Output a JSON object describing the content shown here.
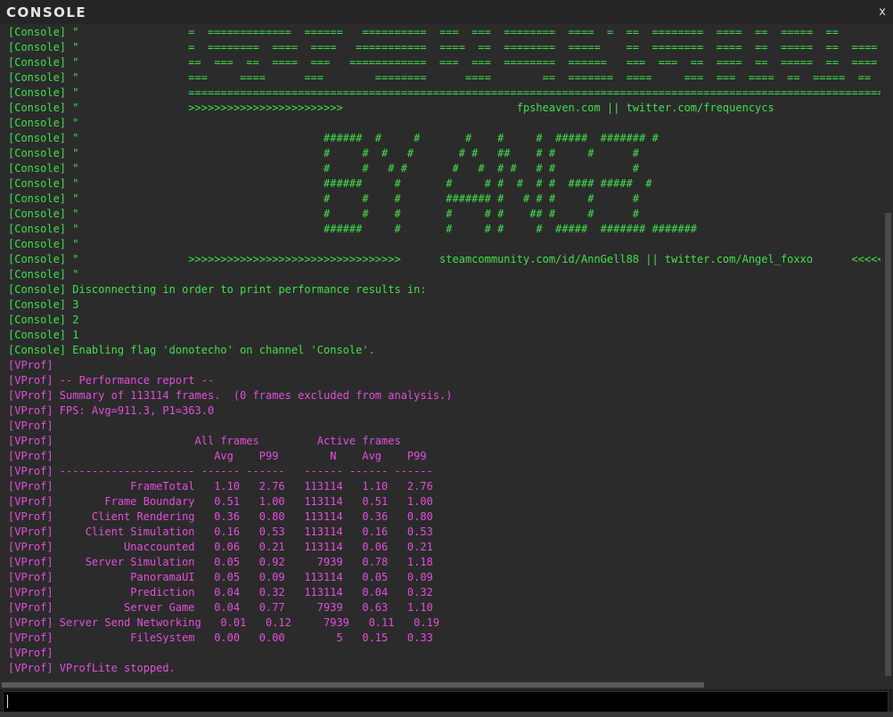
{
  "window": {
    "title": "CONSOLE",
    "close_label": "x"
  },
  "colors": {
    "console_text": "#40e04a",
    "vprof_text": "#e24fdc",
    "background": "#2b2b2b",
    "titlebar": "#252525",
    "input_background": "#000000"
  },
  "console": {
    "lines": [
      {
        "channel": "console",
        "text": "[Console] \"                 =  =============  ======   ==========  ===  ===  ========  ====  =  ==  ========  ====  ==  =====  ==        =="
      },
      {
        "channel": "console",
        "text": "[Console] \"                 =  ========  ====  ====   ===========  ====  ==  ========  =====    ==  ========  ====  ==  =====  ==  ====  =="
      },
      {
        "channel": "console",
        "text": "[Console] \"                 ==  ===  ==  ====  ===   ============  ===  ===  ========  ======   ===  ===  ==  ====  ==  =====  ==  ====  =="
      },
      {
        "channel": "console",
        "text": "[Console] \"                 ===     ====      ===        ========      ====        ==  =======  ====     ===  ===  ====  ==  =====  ==  ====  =="
      },
      {
        "channel": "console",
        "text": "[Console] \"                 ===================================================================================================================="
      },
      {
        "channel": "console",
        "text": "[Console] \"                 >>>>>>>>>>>>>>>>>>>>>>>>                           fpsheaven.com || twitter.com/frequencycs                   <<<<<<<<"
      },
      {
        "channel": "console",
        "text": "[Console] \""
      },
      {
        "channel": "console",
        "text": "[Console] \"                                      ######  #     #       #    #     #  #####  ####### #"
      },
      {
        "channel": "console",
        "text": "[Console] \"                                      #     #  #   #       # #   ##    # #     #      #"
      },
      {
        "channel": "console",
        "text": "[Console] \"                                      #     #   # #       #   #  # #   # #            #"
      },
      {
        "channel": "console",
        "text": "[Console] \"                                      ######     #       #     # #  #  # #  #### #####  #"
      },
      {
        "channel": "console",
        "text": "[Console] \"                                      #     #    #       ####### #   # # #     #      #"
      },
      {
        "channel": "console",
        "text": "[Console] \"                                      #     #    #       #     # #    ## #     #      #"
      },
      {
        "channel": "console",
        "text": "[Console] \"                                      ######     #       #     # #     #  #####  ####### #######"
      },
      {
        "channel": "console",
        "text": "[Console] \""
      },
      {
        "channel": "console",
        "text": "[Console] \"                 >>>>>>>>>>>>>>>>>>>>>>>>>>>>>>>>>      steamcommunity.com/id/AnnGell88 || twitter.com/Angel_foxxo      <<<<<<<<<<<"
      },
      {
        "channel": "console",
        "text": "[Console] \""
      },
      {
        "channel": "console",
        "text": "[Console] Disconnecting in order to print performance results in:"
      },
      {
        "channel": "console",
        "text": "[Console] 3"
      },
      {
        "channel": "console",
        "text": "[Console] 2"
      },
      {
        "channel": "console",
        "text": "[Console] 1"
      },
      {
        "channel": "console",
        "text": "[Console] Enabling flag 'donotecho' on channel 'Console'."
      },
      {
        "channel": "vprof",
        "text": "[VProf]"
      },
      {
        "channel": "vprof",
        "text": "[VProf] -- Performance report --"
      },
      {
        "channel": "vprof",
        "text": "[VProf] Summary of 113114 frames.  (0 frames excluded from analysis.)"
      },
      {
        "channel": "vprof",
        "text": "[VProf] FPS: Avg=911.3, P1=363.0"
      },
      {
        "channel": "vprof",
        "text": "[VProf]"
      },
      {
        "channel": "vprof",
        "text": "[VProf]                      All frames         Active frames"
      },
      {
        "channel": "vprof",
        "text": "[VProf]                         Avg    P99        N    Avg    P99"
      },
      {
        "channel": "vprof",
        "text": "[VProf] --------------------- ------ ------   ------ ------ ------"
      },
      {
        "channel": "vprof",
        "text": "[VProf]            FrameTotal   1.10   2.76   113114   1.10   2.76"
      },
      {
        "channel": "vprof",
        "text": "[VProf]        Frame Boundary   0.51   1.00   113114   0.51   1.00"
      },
      {
        "channel": "vprof",
        "text": "[VProf]      Client Rendering   0.36   0.80   113114   0.36   0.80"
      },
      {
        "channel": "vprof",
        "text": "[VProf]     Client Simulation   0.16   0.53   113114   0.16   0.53"
      },
      {
        "channel": "vprof",
        "text": "[VProf]           Unaccounted   0.06   0.21   113114   0.06   0.21"
      },
      {
        "channel": "vprof",
        "text": "[VProf]     Server Simulation   0.05   0.92     7939   0.78   1.18"
      },
      {
        "channel": "vprof",
        "text": "[VProf]            PanoramaUI   0.05   0.09   113114   0.05   0.09"
      },
      {
        "channel": "vprof",
        "text": "[VProf]            Prediction   0.04   0.32   113114   0.04   0.32"
      },
      {
        "channel": "vprof",
        "text": "[VProf]           Server Game   0.04   0.77     7939   0.63   1.10"
      },
      {
        "channel": "vprof",
        "text": "[VProf] Server Send Networking   0.01   0.12     7939   0.11   0.19"
      },
      {
        "channel": "vprof",
        "text": "[VProf]            FileSystem   0.00   0.00        5   0.15   0.33"
      },
      {
        "channel": "vprof",
        "text": "[VProf]"
      },
      {
        "channel": "vprof",
        "text": "[VProf] VProfLite stopped."
      }
    ]
  },
  "input": {
    "value": "",
    "placeholder": ""
  }
}
